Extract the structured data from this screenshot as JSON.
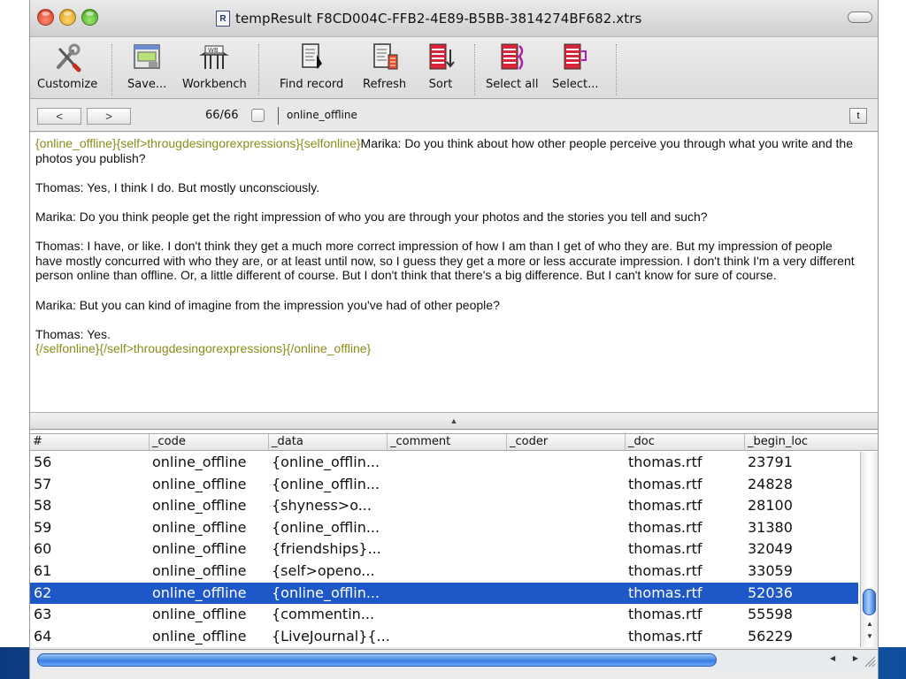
{
  "window": {
    "title": "tempResult F8CD004C-FFB2-4E89-B5BB-3814274BF682.xtrs",
    "doc_icon_glyph": "R"
  },
  "toolbar": {
    "customize": "Customize",
    "save": "Save...",
    "workbench": "Workbench",
    "find_record": "Find record",
    "refresh": "Refresh",
    "sort": "Sort",
    "select_all": "Select all",
    "select": "Select..."
  },
  "nav": {
    "prev": "<",
    "next": ">",
    "count": "66/66",
    "code": "online_offline",
    "t_button": "t"
  },
  "text": {
    "open_tags": "{online_offline}{self>througdesingorexpressions}{selfonline}",
    "p1": "Marika: Do you think about how other people perceive you through what you write and the photos you publish?",
    "p2": "Thomas: Yes, I think I do. But mostly unconsciously.",
    "p3": "Marika: Do you think people get the right impression of who you are through your photos and the stories you tell and such?",
    "p4": "Thomas: I have, or like. I don't think they get a much more correct impression of how I am than I get of who they are. But my impression of people have mostly concurred with who they are, or at least until now, so I guess they get a more or less accurate impression. I don't think I'm a very different person online than offline. Or, a little different of course. But I don't think that there's a big difference. But I can't know for sure of course.",
    "p5": "Marika: But you can kind of imagine from the impression you've had of other people?",
    "p6": "Thomas: Yes.",
    "close_tags": "{/selfonline}{/self>througdesingorexpressions}{/online_offline}"
  },
  "table": {
    "columns": [
      "#",
      "_code",
      "_data",
      "_comment",
      "_coder",
      "_doc",
      "_begin_loc"
    ],
    "selected_row": "62",
    "rows": [
      {
        "num": "56",
        "code": "online_offline",
        "data": "{online_offlin...",
        "comment": "",
        "coder": "",
        "doc": "thomas.rtf",
        "begin": "23791"
      },
      {
        "num": "57",
        "code": "online_offline",
        "data": "{online_offlin...",
        "comment": "",
        "coder": "",
        "doc": "thomas.rtf",
        "begin": "24828"
      },
      {
        "num": "58",
        "code": "online_offline",
        "data": "{shyness>o...",
        "comment": "",
        "coder": "",
        "doc": "thomas.rtf",
        "begin": "28100"
      },
      {
        "num": "59",
        "code": "online_offline",
        "data": "{online_offlin...",
        "comment": "",
        "coder": "",
        "doc": "thomas.rtf",
        "begin": "31380"
      },
      {
        "num": "60",
        "code": "online_offline",
        "data": "{friendships}...",
        "comment": "",
        "coder": "",
        "doc": "thomas.rtf",
        "begin": "32049"
      },
      {
        "num": "61",
        "code": "online_offline",
        "data": "{self>openo...",
        "comment": "",
        "coder": "",
        "doc": "thomas.rtf",
        "begin": "33059"
      },
      {
        "num": "62",
        "code": "online_offline",
        "data": "{online_offlin...",
        "comment": "",
        "coder": "",
        "doc": "thomas.rtf",
        "begin": "52036"
      },
      {
        "num": "63",
        "code": "online_offline",
        "data": "{commentin...",
        "comment": "",
        "coder": "",
        "doc": "thomas.rtf",
        "begin": "55598"
      },
      {
        "num": "64",
        "code": "online_offline",
        "data": "{LiveJournal}{...",
        "comment": "",
        "coder": "",
        "doc": "thomas.rtf",
        "begin": "56229"
      }
    ]
  },
  "colors": {
    "selection": "#1e58c8",
    "tag_text": "#8c8c1a",
    "aqua_blue": "#3b7fe0"
  },
  "icons": [
    "wrench-screwdriver-icon",
    "save-window-icon",
    "workbench-icon",
    "find-record-icon",
    "refresh-icon",
    "sort-icon",
    "select-all-icon",
    "select-icon"
  ]
}
